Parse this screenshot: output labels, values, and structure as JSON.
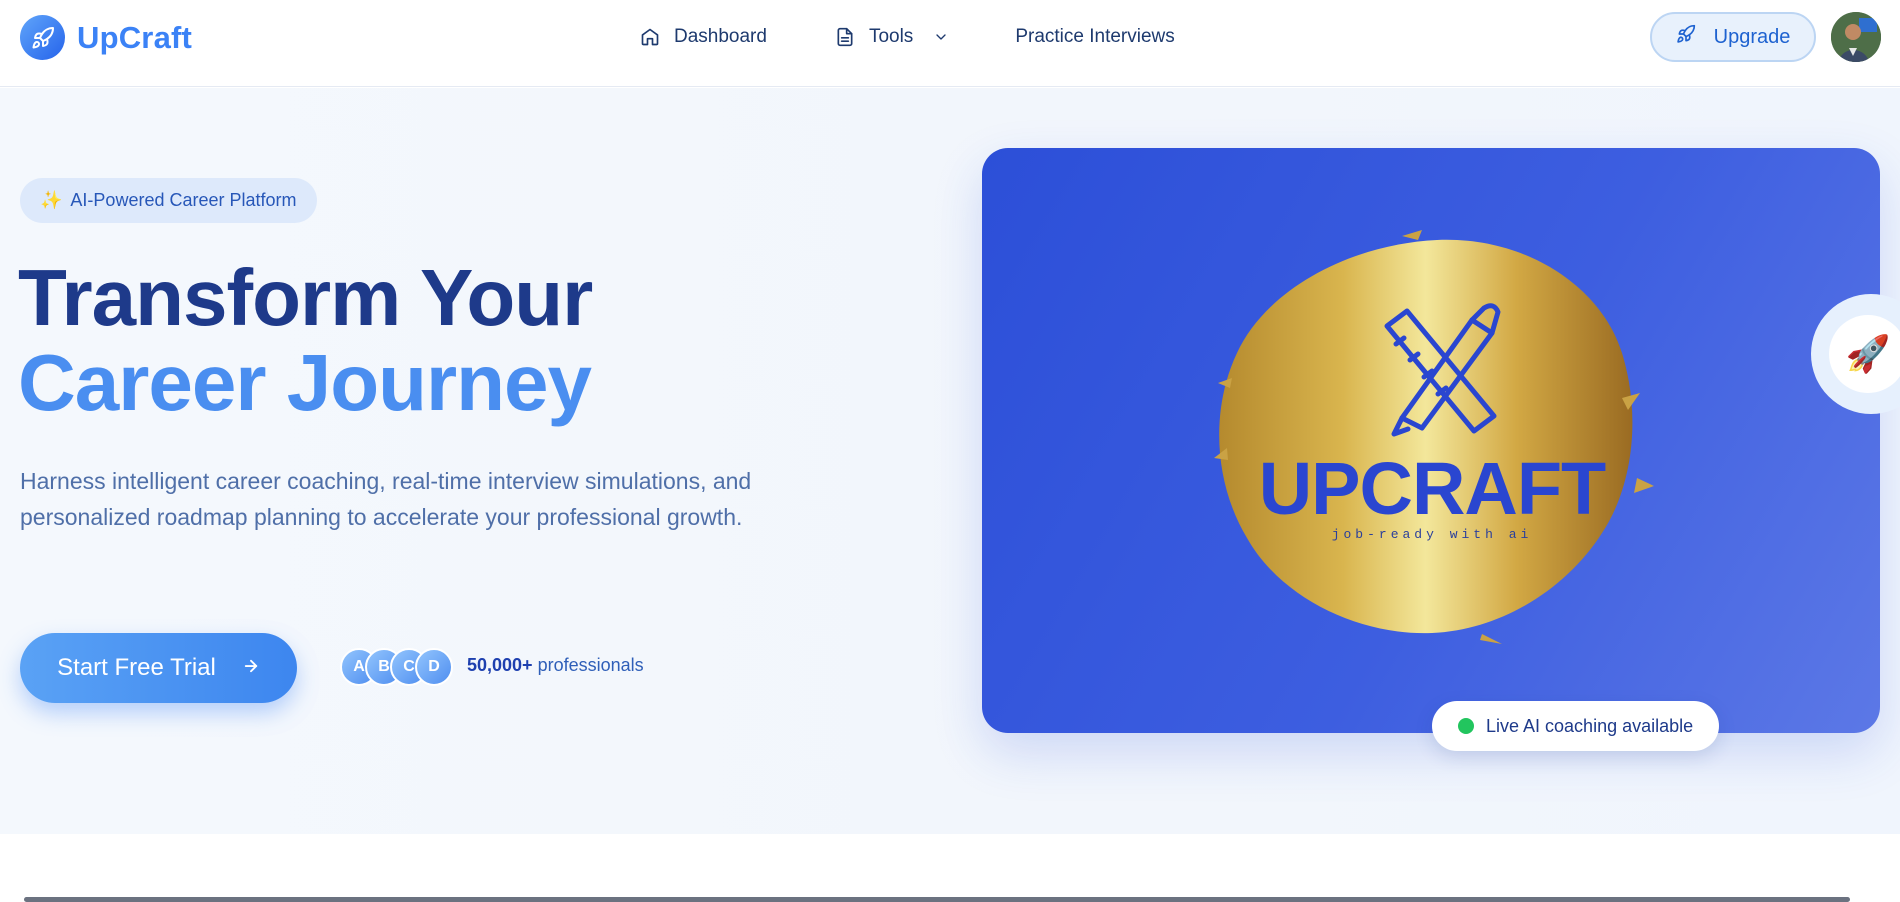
{
  "nav": {
    "brand": "UpCraft",
    "links": [
      {
        "label": "Dashboard",
        "icon": "home-icon"
      },
      {
        "label": "Tools",
        "icon": "document-icon"
      },
      {
        "label": "Practice Interviews"
      }
    ],
    "upgrade_label": "Upgrade"
  },
  "hero": {
    "badge": "AI-Powered Career Platform",
    "title_line1": "Transform Your",
    "title_line2": "Career Journey",
    "description": "Harness intelligent career coaching, real-time interview simulations, and personalized roadmap planning to accelerate your professional growth.",
    "cta_label": "Start Free Trial",
    "avatar_initials": [
      "A",
      "B",
      "C",
      "D"
    ],
    "social_count": "50,000+",
    "social_text": "professionals",
    "logo_title": "UPCRAFT",
    "logo_tagline": "job-ready with ai",
    "live_badge": "Live AI coaching available"
  },
  "colors": {
    "primary": "#3b82f6",
    "navy": "#1e3a8a",
    "accent_light": "#4a8ef0",
    "card_blue": "#2c4fd8",
    "gold": "#d4b24a",
    "live_dot": "#22c55e"
  }
}
